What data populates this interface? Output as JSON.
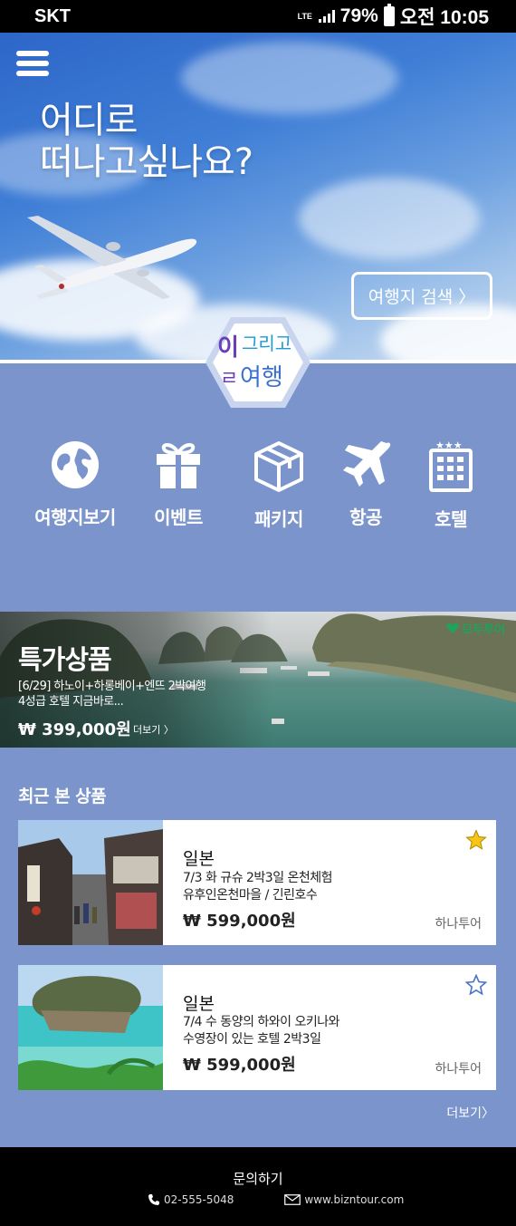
{
  "status_bar": {
    "carrier": "SKT",
    "network": "LTE",
    "battery": "79%",
    "time": "오전 10:05"
  },
  "hero": {
    "title_line1": "어디로",
    "title_line2": "떠나고싶나요?",
    "search_button": "여행지 검색 〉"
  },
  "logo": {
    "line1": "일그리고",
    "line2": "여행",
    "colors": [
      "#6a3fb5",
      "#1e9ad6",
      "#3b6fd1"
    ]
  },
  "categories": [
    {
      "label": "여행지보기",
      "icon": "globe-icon"
    },
    {
      "label": "이벤트",
      "icon": "gift-icon"
    },
    {
      "label": "패키지",
      "icon": "package-box-icon"
    },
    {
      "label": "항공",
      "icon": "airplane-icon"
    },
    {
      "label": "호텔",
      "icon": "hotel-icon"
    }
  ],
  "banner": {
    "title": "특가상품",
    "desc_line1": "[6/29] 하노이+하롱베이+엔뜨 2박여행",
    "desc_line2": "4성급 호텔 지금바로...",
    "price": "₩ 399,000원",
    "more": "더보기 〉",
    "partner": "모두투어"
  },
  "recent": {
    "title": "최근 본 상품",
    "items": [
      {
        "country": "일본",
        "desc_line1": "7/3 화 규슈 2박3일  온천체험",
        "desc_line2": "유후인온천마을 / 긴린호수",
        "price": "₩ 599,000원",
        "agency": "하나투어",
        "starred": true
      },
      {
        "country": "일본",
        "desc_line1": "7/4 수  동양의 하와이 오키나와",
        "desc_line2": "수영장이 있는 호텔 2박3일",
        "price": "₩ 599,000원",
        "agency": "하나투어",
        "starred": false
      }
    ],
    "more": "더보기〉"
  },
  "footer": {
    "title": "문의하기",
    "phone": "02-555-5048",
    "website": "www.bizntour.com"
  },
  "colors": {
    "background": "#7b95cc",
    "star_active": "#f5c518",
    "star_inactive": "#4b73c9",
    "partner_green": "#1fa25a"
  }
}
